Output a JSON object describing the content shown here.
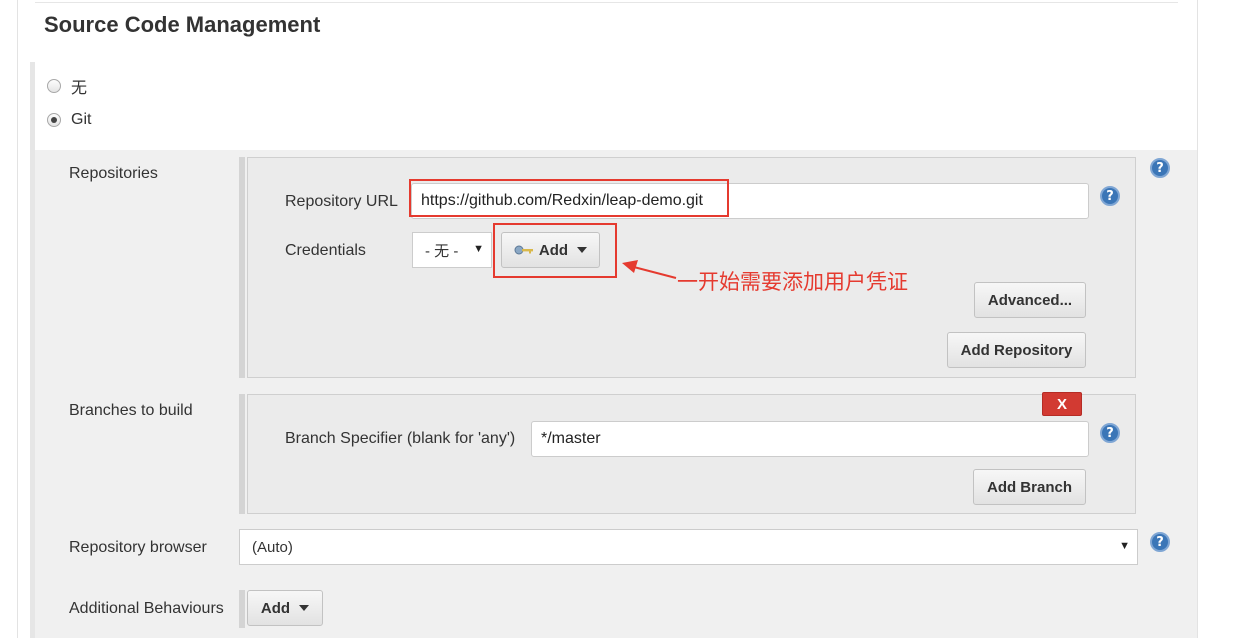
{
  "section": {
    "title": "Source Code Management"
  },
  "scm_options": [
    {
      "label": "无",
      "checked": false
    },
    {
      "label": "Git",
      "checked": true
    }
  ],
  "repositories": {
    "label": "Repositories",
    "url_label": "Repository URL",
    "url_value": "https://github.com/Redxin/leap-demo.git",
    "credentials_label": "Credentials",
    "credentials_selected": "- 无 -",
    "add_label": "Add",
    "advanced_label": "Advanced...",
    "add_repository_label": "Add Repository"
  },
  "branches": {
    "label": "Branches to build",
    "delete_label": "X",
    "specifier_label": "Branch Specifier (blank for 'any')",
    "specifier_value": "*/master",
    "add_branch_label": "Add Branch"
  },
  "repo_browser": {
    "label": "Repository browser",
    "selected": "(Auto)"
  },
  "additional_behaviours": {
    "label": "Additional Behaviours",
    "add_label": "Add"
  },
  "annotation": {
    "text": "一开始需要添加用户凭证",
    "color": "#e53a2f"
  },
  "colors": {
    "help_icon": "#3b76b7",
    "delete_button": "#d23a32"
  }
}
